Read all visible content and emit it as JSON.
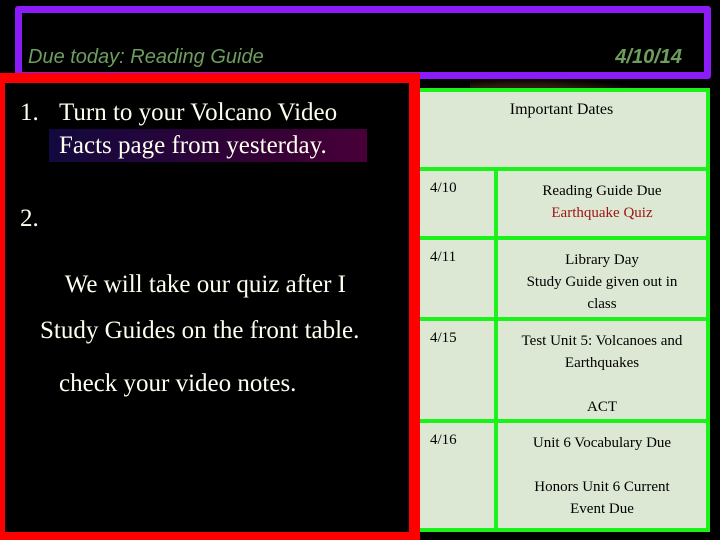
{
  "header": {
    "due_today": "Due today:  Reading Guide",
    "date": "4/10/14"
  },
  "instructions": {
    "items": [
      {
        "number": "1.",
        "line1": "Turn to your Volcano Video",
        "line2": "Facts page from yesterday."
      },
      {
        "number": "2.",
        "line1": " We will take our quiz after I",
        "line2": "check your video notes."
      }
    ],
    "note": "Study Guides on the front table."
  },
  "important_dates": {
    "title": "Important Dates",
    "rows": [
      {
        "date": "4/10",
        "lines": [
          "Reading Guide Due"
        ],
        "highlight": "Earthquake Quiz"
      },
      {
        "date": "4/11",
        "lines": [
          "Library Day",
          "Study Guide given out in",
          "class"
        ]
      },
      {
        "date": "4/15",
        "lines": [
          "Test Unit 5:  Volcanoes and",
          "Earthquakes"
        ],
        "extra": "ACT"
      },
      {
        "date": "4/16",
        "lines": [
          "Unit 6 Vocabulary Due"
        ],
        "extra_lines": [
          "Honors Unit 6 Current",
          "Event Due"
        ]
      }
    ]
  },
  "colors": {
    "title_border": "#8B1CF7",
    "content_border": "#FF0000",
    "table_border": "#1AF21A",
    "table_fill": "#DCE8D4",
    "title_text": "#6E9E5E",
    "highlight_text": "#9E1414"
  }
}
